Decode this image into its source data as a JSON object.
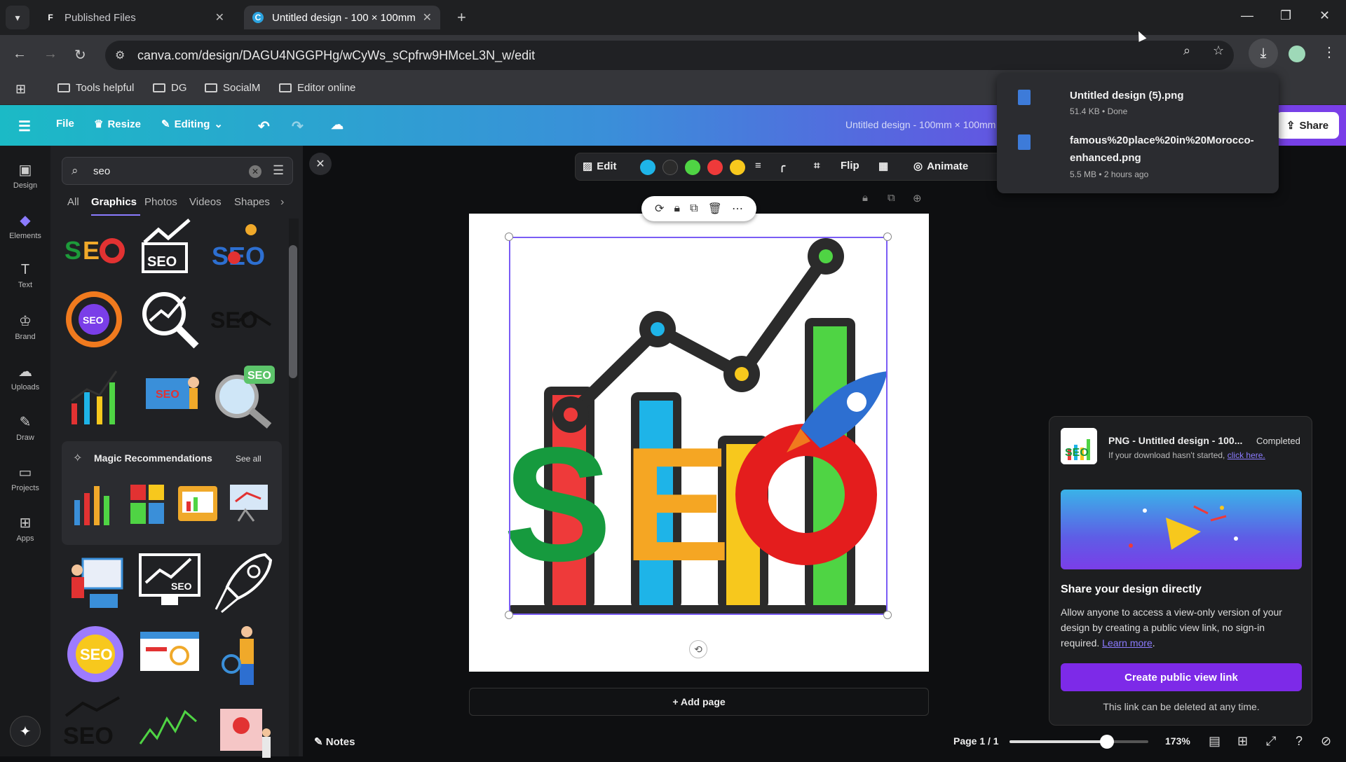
{
  "browser": {
    "tabs": [
      {
        "title": "Published Files",
        "icon": "notion-icon"
      },
      {
        "title": "Untitled design - 100 × 100mm",
        "icon": "canva-icon"
      }
    ],
    "url": "canva.com/design/DAGU4NGGPHg/wCyWs_sCpfrw9HMceL3N_w/edit",
    "bookmarks": [
      "Tools helpful",
      "DG",
      "SocialM",
      "Editor online"
    ]
  },
  "canva_bar": {
    "file": "File",
    "resize": "Resize",
    "editing": "Editing",
    "design_title": "Untitled design - 100mm × 100mm",
    "share": "Share"
  },
  "rail": [
    "Design",
    "Elements",
    "Text",
    "Brand",
    "Uploads",
    "Draw",
    "Projects",
    "Apps"
  ],
  "panel": {
    "search_value": "seo",
    "categories": [
      "All",
      "Graphics",
      "Photos",
      "Videos",
      "Shapes"
    ],
    "active_category": "Graphics",
    "magic_title": "Magic Recommendations",
    "magic_see_all": "See all"
  },
  "toolbar": {
    "edit": "Edit",
    "flip": "Flip",
    "animate": "Animate",
    "colors": [
      "#1eb4e8",
      "#2b2b2b",
      "#4fd444",
      "#ee3a3a",
      "#f7c81d"
    ]
  },
  "canvas": {
    "add_page": "+ Add page",
    "seo_letters": "SEO"
  },
  "bottom": {
    "notes": "Notes",
    "page": "Page 1 / 1",
    "zoom": "173%",
    "zoom_fraction": 0.7
  },
  "downloads": [
    {
      "name": "Untitled design (5).png",
      "meta": "51.4 KB • Done"
    },
    {
      "name": "famous%20place%20in%20Morocco-enhanced.png",
      "meta": "5.5 MB • 2 hours ago"
    }
  ],
  "share_card": {
    "title": "PNG - Untitled design - 100...",
    "status": "Completed",
    "sub_text": "If your download hasn't started, ",
    "sub_link": "click here.",
    "heading": "Share your design directly",
    "body": "Allow anyone to access a view-only version of your design by creating a public view link, no sign-in required. ",
    "body_link": "Learn more",
    "button": "Create public view link",
    "footer": "This link can be deleted at any time."
  }
}
